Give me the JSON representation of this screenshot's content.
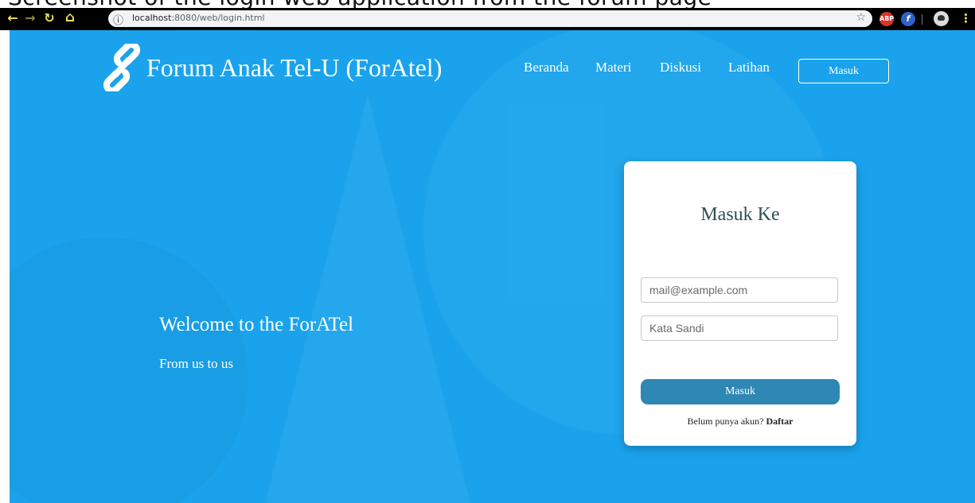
{
  "top_strip": {
    "text": "Screenshot of the login web application from the forum page"
  },
  "browser": {
    "url_host": "localhost",
    "url_rest": ":8080/web/login.html",
    "ext_abp": "ABP",
    "ext_fire": "f"
  },
  "brand": {
    "title": "Forum Anak Tel-U (ForAtel)"
  },
  "nav": {
    "beranda": "Beranda",
    "materi": "Materi",
    "diskusi": "Diskusi",
    "latihan": "Latihan",
    "masuk": "Masuk"
  },
  "hero": {
    "welcome": "Welcome to the ForATel",
    "tagline": "From us to us"
  },
  "login": {
    "title": "Masuk Ke",
    "email_placeholder": "mail@example.com",
    "password_placeholder": "Kata Sandi",
    "submit_label": "Masuk",
    "signup_prompt": "Belum punya akun?",
    "signup_link": "Daftar"
  },
  "colors": {
    "background": "#1aa3ec",
    "submit_button": "#2f87b3",
    "card_title": "#2f4f4f"
  }
}
